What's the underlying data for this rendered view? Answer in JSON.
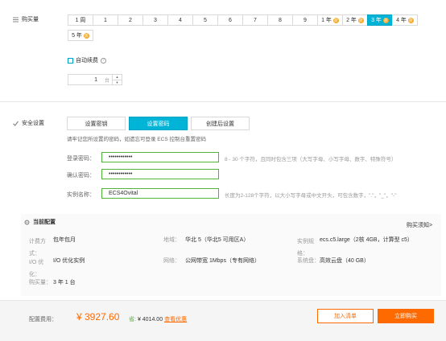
{
  "purchase": {
    "label": "购买量",
    "durations": [
      "1 周",
      "1",
      "2",
      "3",
      "4",
      "5",
      "6",
      "7",
      "8",
      "9",
      "1 年",
      "2 年",
      "3 年",
      "4 年",
      "5 年"
    ],
    "selected_duration": "3 年",
    "auto_renew_label": "自动续费",
    "quantity_value": "1",
    "quantity_unit": "台"
  },
  "security": {
    "label": "安全设置",
    "tabs": [
      "设置密钥",
      "设置密码",
      "创建后设置"
    ],
    "selected_tab": "设置密码",
    "notice": "请牢记您所设置的密码，如遗忘可登录 ECS 控制台重置密码",
    "login_password_label": "登录密码：",
    "login_password_value": "••••••••••••",
    "login_password_hint": "8 - 30 个字符，且同时包含三项（大写字母、小写字母、数字、特殊符号）",
    "confirm_password_label": "确认密码：",
    "confirm_password_value": "••••••••••••",
    "instance_name_label": "实例名称：",
    "instance_name_value": "ECS4Ovital",
    "instance_name_hint": "长度为2-128个字符，以大小写字母或中文开头，可包含数字，\".\"，\"_\"，\"-\""
  },
  "current_config": {
    "title": "当前配置",
    "purchase_notice_link": "购买须知>",
    "rows": [
      [
        {
          "k": "计费方式：",
          "v": "包年包月"
        },
        {
          "k": "地域：",
          "v": "华北 5（华北5 可用区A）"
        },
        {
          "k": "实例规格：",
          "v": "ecs.c5.large（2核 4GB，计算型 c5）"
        }
      ],
      [
        {
          "k": "I/O 优化：",
          "v": "I/O 优化实例"
        },
        {
          "k": "网络：",
          "v": "公网带宽 1Mbps（专有网络）"
        },
        {
          "k": "系统盘：",
          "v": "高效云盘（40 GB）"
        }
      ],
      [
        {
          "k": "购买量：",
          "v": "3 年 1 台"
        }
      ]
    ]
  },
  "footer": {
    "fee_label": "配置费用：",
    "price": "¥ 3927.60",
    "saved_prefix": "省:",
    "saved_value": "¥ 4014.00",
    "discount_link": "查看优惠",
    "add_to_list_label": "加入清单",
    "buy_now_label": "立即购买"
  },
  "colors": {
    "accent": "#00b4d8",
    "orange": "#ff6a00",
    "discount_badge": "#f5a623",
    "valid_border": "#52b43a",
    "link": "#ff6a00"
  }
}
